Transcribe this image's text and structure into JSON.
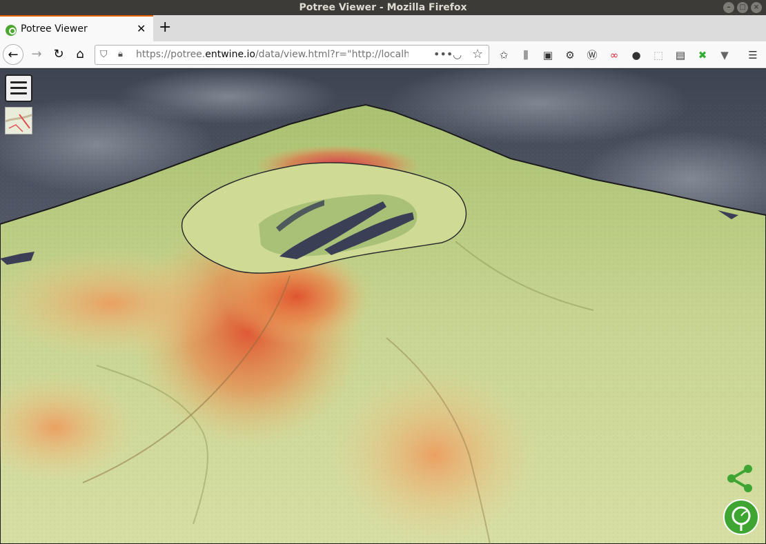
{
  "window": {
    "title": "Potree Viewer - Mozilla Firefox"
  },
  "tabs": [
    {
      "title": "Potree Viewer",
      "close": "✕"
    }
  ],
  "new_tab": "+",
  "nav": {
    "url_prefix": "https://potree.",
    "url_domain": "entwine.io",
    "url_rest": "/data/view.html?r=\"http://localhos",
    "more": "•••"
  },
  "toolbar_icons": [
    "library-icon",
    "sidebar-icon",
    "extension-icon",
    "wappalyzer-icon",
    "colorzilla-icon",
    "account-icon",
    "screenshot-icon",
    "selenium-icon",
    "x-extension-icon",
    "vue-icon",
    "hamburger-menu-icon"
  ],
  "colors": {
    "accent_tab": "#e66000",
    "potree_green": "#3fa532"
  }
}
